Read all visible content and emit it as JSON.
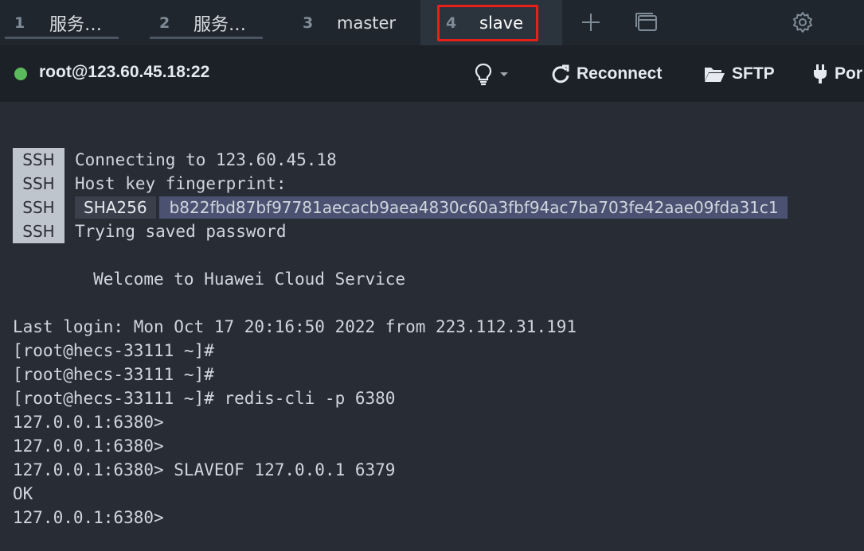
{
  "tabs": [
    {
      "number": "1",
      "title": "服务…"
    },
    {
      "number": "2",
      "title": "服务…"
    },
    {
      "number": "3",
      "title": "master"
    },
    {
      "number": "4",
      "title": "slave"
    }
  ],
  "toolbar_icons": {
    "add_tab": "plus-icon",
    "overview": "window-icon",
    "settings": "gear-icon"
  },
  "session": {
    "host": "root@123.60.45.18:22",
    "status_color": "#5cb85c",
    "reconnect_label": "Reconnect",
    "sftp_label": "SFTP",
    "port_label": "Por"
  },
  "terminal": {
    "ssh_badge": "SSH",
    "ssh_lines": {
      "connecting": "Connecting to 123.60.45.18",
      "fingerprint_label": "Host key fingerprint:",
      "algorithm": "SHA256",
      "fingerprint": "b822fbd87bf97781aecacb9aea4830c60a3fbf94ac7ba703fe42aae09fda31c1",
      "password": "Trying saved password"
    },
    "welcome": "        Welcome to Huawei Cloud Service",
    "output": [
      "Last login: Mon Oct 17 20:16:50 2022 from 223.112.31.191",
      "[root@hecs-33111 ~]#",
      "[root@hecs-33111 ~]#",
      "[root@hecs-33111 ~]# redis-cli -p 6380",
      "127.0.0.1:6380>",
      "127.0.0.1:6380>",
      "127.0.0.1:6380> SLAVEOF 127.0.0.1 6379",
      "OK",
      "127.0.0.1:6380>"
    ]
  },
  "colors": {
    "highlight": "#e8201a",
    "fingerprint_bg": "#4b5271"
  }
}
